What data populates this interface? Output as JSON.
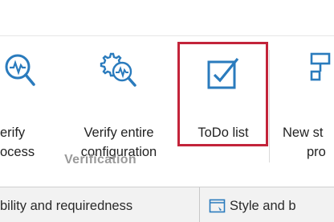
{
  "ribbon": {
    "buttons": [
      {
        "line1": "erify",
        "line2": "ocess",
        "icon": "verify-process-icon"
      },
      {
        "line1": "Verify entire",
        "line2": "configuration",
        "icon": "verify-configuration-icon"
      },
      {
        "line1": "ToDo list",
        "line2": "",
        "icon": "todo-checkbox-icon"
      },
      {
        "line1": "New st",
        "line2": "pro",
        "icon": "new-structure-icon"
      }
    ],
    "group_label": "Verification",
    "highlight_color": "#c3243a"
  },
  "bottom_tabs": [
    {
      "label": "bility and requiredness"
    },
    {
      "label": "Style and b",
      "icon": "style-icon"
    }
  ]
}
